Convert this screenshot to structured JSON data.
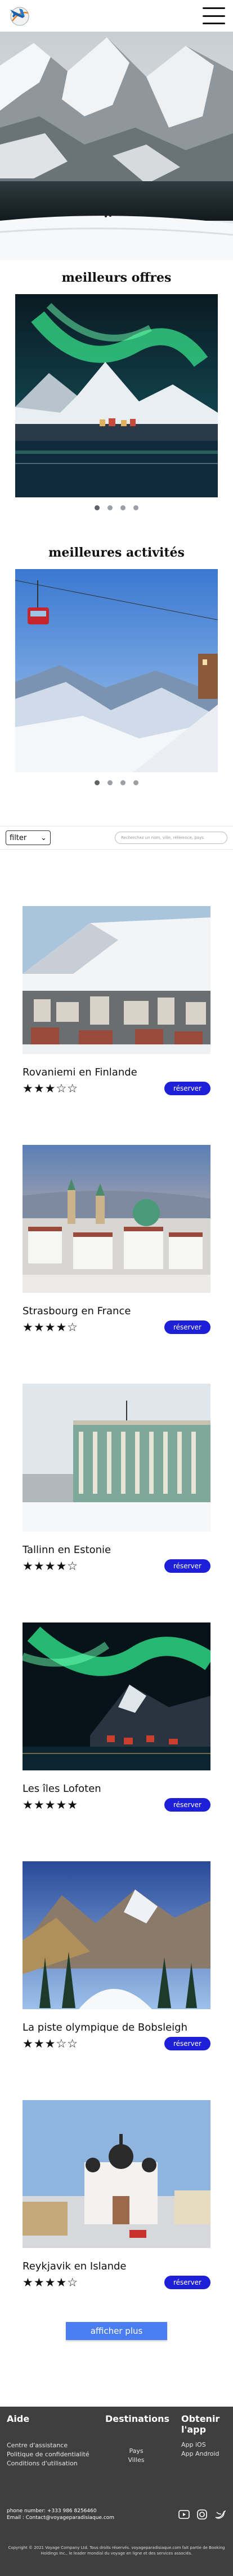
{
  "header": {
    "logo_icon": "plane-globe-logo",
    "menu_icon": "hamburger-menu-icon"
  },
  "offers": {
    "title": "meilleurs offres",
    "dots": 4,
    "active": 0
  },
  "activities": {
    "title": "meilleures activités",
    "dots": 4,
    "active": 0
  },
  "filter": {
    "label": "filter",
    "search_placeholder": "Recherchez un nom, ville, référence, pays"
  },
  "destinations": [
    {
      "name": "Rovaniemi en Finlande",
      "stars": "★★★☆☆",
      "rating": 2.5,
      "button": "réserver"
    },
    {
      "name": "Strasbourg en France",
      "stars": "★★★★☆",
      "rating": 4.5,
      "button": "réserver"
    },
    {
      "name": "Tallinn en Estonie",
      "stars": "★★★★☆",
      "rating": 3.5,
      "button": "réserver"
    },
    {
      "name": "Les îles Lofoten",
      "stars": "★★★★★",
      "rating": 5,
      "button": "réserver"
    },
    {
      "name": "La piste olympique de Bobsleigh",
      "stars": "★★★☆☆",
      "rating": 2.5,
      "button": "réserver"
    },
    {
      "name": "Reykjavik en Islande",
      "stars": "★★★★☆",
      "rating": 4.5,
      "button": "réserver"
    }
  ],
  "more_button": "afficher plus",
  "footer": {
    "aide": {
      "title": "Aide",
      "links": [
        "Centre d'assistance",
        "Politique de confidentialité",
        "Conditions d'utilisation"
      ]
    },
    "destinations": {
      "title": "Destinations",
      "links": [
        "Pays",
        "Villes"
      ]
    },
    "app": {
      "title": "Obtenir l'app",
      "links": [
        "App iOS",
        "App Android"
      ]
    },
    "contact": {
      "phone": "phone number: +333 986 8256460",
      "email": "Email :  Contact@voyageparadisiaque.com"
    },
    "copyright": "Copyright © 2021 Voyage Company Ltd. Tous droits réservés. voyageparadisiaque.com fait partie de Booking Holdings Inc., le leader mondial du voyage en ligne et des services associés."
  }
}
